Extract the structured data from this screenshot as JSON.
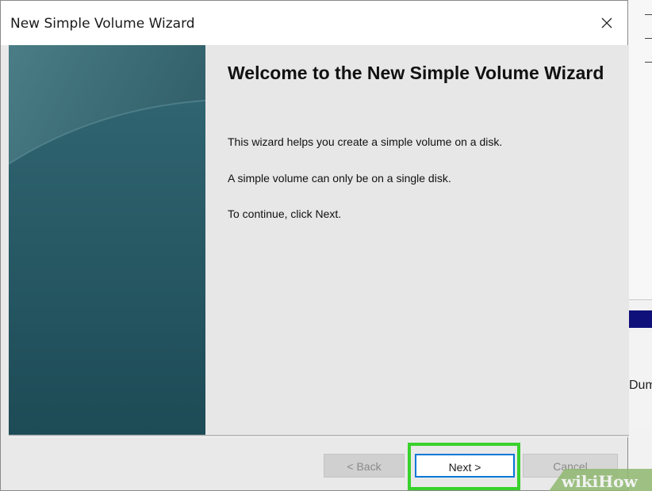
{
  "window": {
    "title": "New Simple Volume Wizard",
    "close_symbol": "×"
  },
  "content": {
    "heading": "Welcome to the New Simple Volume Wizard",
    "paragraphs": [
      "This wizard helps you create a simple volume on a disk.",
      "A simple volume can only be on a single disk.",
      "To continue, click Next."
    ]
  },
  "buttons": {
    "back": "< Back",
    "next": "Next >",
    "cancel": "Cancel"
  },
  "background_app": {
    "partial_text": "Dum"
  },
  "watermark": {
    "brand": "wikiHow"
  },
  "colors": {
    "highlight": "#39d12c",
    "banner": "#2c5c68",
    "focus_border": "#0078d7"
  }
}
